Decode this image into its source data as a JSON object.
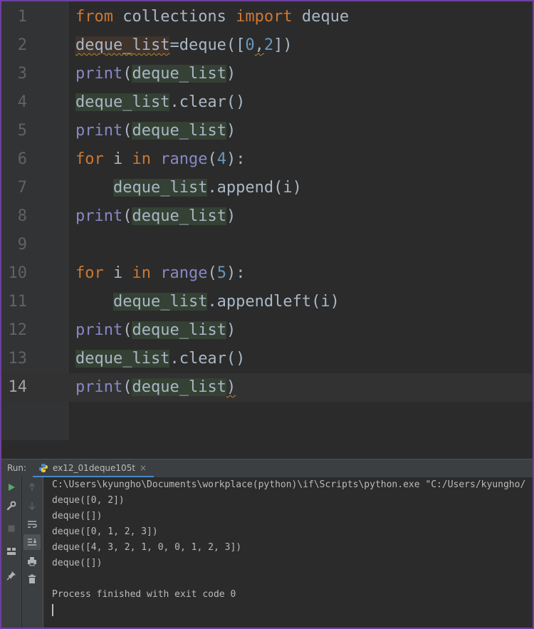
{
  "editor": {
    "current_line": 14,
    "lines": [
      {
        "n": "1",
        "tokens": [
          [
            "kw",
            "from"
          ],
          [
            "t",
            " collections "
          ],
          [
            "kw",
            "import"
          ],
          [
            "t",
            " deque"
          ]
        ]
      },
      {
        "n": "2",
        "tokens": [
          [
            "var2sq",
            "deque_list"
          ],
          [
            "t",
            "="
          ],
          [
            "t",
            "deque(["
          ],
          [
            "num",
            "0"
          ],
          [
            "sq",
            ","
          ],
          [
            "num",
            "2"
          ],
          [
            "t",
            "])"
          ]
        ]
      },
      {
        "n": "3",
        "tokens": [
          [
            "bi",
            "print"
          ],
          [
            "t",
            "("
          ],
          [
            "var",
            "deque_list"
          ],
          [
            "t",
            ")"
          ]
        ]
      },
      {
        "n": "4",
        "tokens": [
          [
            "var",
            "deque_list"
          ],
          [
            "t",
            ".clear()"
          ]
        ]
      },
      {
        "n": "5",
        "tokens": [
          [
            "bi",
            "print"
          ],
          [
            "t",
            "("
          ],
          [
            "var",
            "deque_list"
          ],
          [
            "t",
            ")"
          ]
        ]
      },
      {
        "n": "6",
        "tokens": [
          [
            "kw",
            "for"
          ],
          [
            "t",
            " i "
          ],
          [
            "kw",
            "in"
          ],
          [
            "t",
            " "
          ],
          [
            "bi",
            "range"
          ],
          [
            "t",
            "("
          ],
          [
            "num",
            "4"
          ],
          [
            "t",
            "):"
          ]
        ]
      },
      {
        "n": "7",
        "tokens": [
          [
            "t",
            "    "
          ],
          [
            "var",
            "deque_list"
          ],
          [
            "t",
            ".append(i)"
          ]
        ]
      },
      {
        "n": "8",
        "tokens": [
          [
            "bi",
            "print"
          ],
          [
            "t",
            "("
          ],
          [
            "var",
            "deque_list"
          ],
          [
            "t",
            ")"
          ]
        ]
      },
      {
        "n": "9",
        "tokens": []
      },
      {
        "n": "10",
        "tokens": [
          [
            "kw",
            "for"
          ],
          [
            "t",
            " i "
          ],
          [
            "kw",
            "in"
          ],
          [
            "t",
            " "
          ],
          [
            "bi",
            "range"
          ],
          [
            "t",
            "("
          ],
          [
            "num",
            "5"
          ],
          [
            "t",
            "):"
          ]
        ]
      },
      {
        "n": "11",
        "tokens": [
          [
            "t",
            "    "
          ],
          [
            "var",
            "deque_list"
          ],
          [
            "t",
            ".appendleft(i)"
          ]
        ]
      },
      {
        "n": "12",
        "tokens": [
          [
            "bi",
            "print"
          ],
          [
            "t",
            "("
          ],
          [
            "var",
            "deque_list"
          ],
          [
            "t",
            ")"
          ]
        ]
      },
      {
        "n": "13",
        "tokens": [
          [
            "var",
            "deque_list"
          ],
          [
            "t",
            ".clear()"
          ]
        ]
      },
      {
        "n": "14",
        "tokens": [
          [
            "bi",
            "print"
          ],
          [
            "t",
            "("
          ],
          [
            "var",
            "deque_list"
          ],
          [
            "sq",
            ")"
          ]
        ]
      }
    ]
  },
  "run_panel": {
    "label": "Run:",
    "tab_name": "ex12_01deque105t",
    "tab_close": "×",
    "output": [
      "C:\\Users\\kyungho\\Documents\\workplace(python)\\if\\Scripts\\python.exe \"C:/Users/kyungho/",
      "deque([0, 2])",
      "deque([])",
      "deque([0, 1, 2, 3])",
      "deque([4, 3, 2, 1, 0, 0, 1, 2, 3])",
      "deque([])",
      "",
      "Process finished with exit code 0"
    ]
  },
  "icons": {
    "run": "run-icon",
    "wrench": "wrench-icon",
    "stop": "stop-icon",
    "layout": "layout-icon",
    "pin": "pin-icon",
    "up": "arrow-up-icon",
    "down": "arrow-down-icon",
    "wrap": "soft-wrap-icon",
    "scroll": "scroll-to-end-icon",
    "print": "print-icon",
    "trash": "trash-icon",
    "python": "python-icon"
  },
  "colors": {
    "keyword": "#cc7832",
    "builtin": "#8888c6",
    "number": "#6897bb",
    "text": "#a9b7c6",
    "run_green": "#59a869",
    "accent": "#4a88c7"
  }
}
